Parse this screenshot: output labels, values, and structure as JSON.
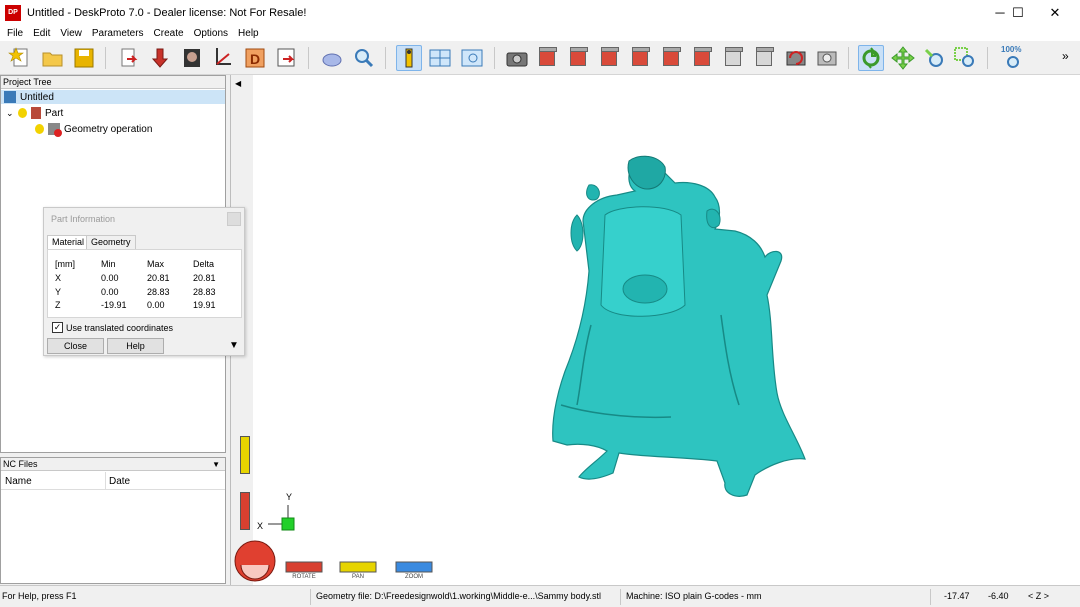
{
  "window": {
    "logo": "DP",
    "title": "Untitled - DeskProto 7.0 - Dealer license: Not For Resale!",
    "minimize_icon": "─",
    "maximize_icon": "☐",
    "close_icon": "✕"
  },
  "menu": [
    "File",
    "Edit",
    "View",
    "Parameters",
    "Create",
    "Options",
    "Help"
  ],
  "toolbar": {
    "zoom_label": "100%",
    "overflow": "»"
  },
  "project_tree": {
    "header": "Project Tree",
    "root": "Untitled",
    "part": "Part",
    "operation": "Geometry operation"
  },
  "part_info": {
    "title": "Part Information",
    "tabs": [
      "Material",
      "Geometry"
    ],
    "headers": [
      "[mm]",
      "Min",
      "Max",
      "Delta"
    ],
    "rows": [
      [
        "X",
        "0.00",
        "20.81",
        "20.81"
      ],
      [
        "Y",
        "0.00",
        "28.83",
        "28.83"
      ],
      [
        "Z",
        "-19.91",
        "0.00",
        "19.91"
      ]
    ],
    "checkbox_label": "Use translated coordinates",
    "close_label": "Close",
    "help_label": "Help"
  },
  "nc_files": {
    "header": "NC Files",
    "columns": [
      "Name",
      "Date"
    ]
  },
  "viewport": {
    "axis_x": "X",
    "axis_y": "Y",
    "rotate_label": "ROTATE",
    "pan_label": "PAN",
    "zoom_label": "ZOOM",
    "model_color": "#2ec4c0"
  },
  "status": {
    "help": "For Help, press F1",
    "geometry_file": "Geometry file: D:\\Freedesignwold\\1.working\\Middle-e...\\Sammy body.stl",
    "machine": "Machine: ISO plain G-codes - mm",
    "coord_x": "-17.47",
    "coord_y": "-6.40",
    "axis_mode": "< Z >"
  }
}
